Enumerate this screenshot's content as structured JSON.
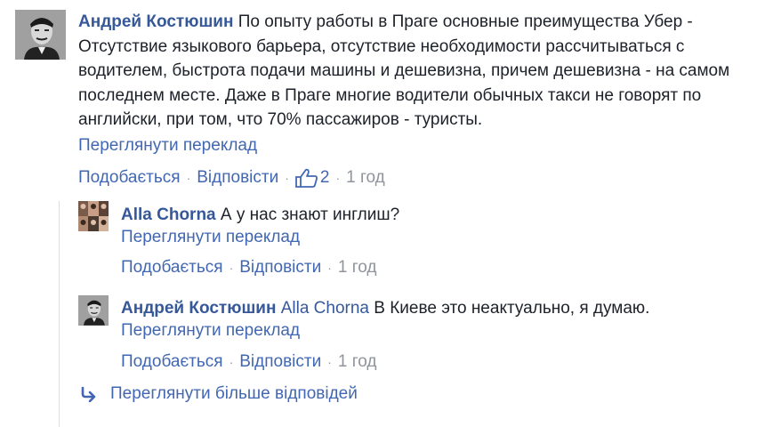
{
  "comment": {
    "author": "Андрей Костюшин",
    "text": "По опыту работы в Праге основные преимущества Убер - Отсутствие языкового барьера, отсутствие необходимости рассчитываться с водителем, быстрота подачи машины и дешевизна, причем дешевизна - на самом последнем месте. Даже в Праге многие водители обычных такси не говорят по английски, при том, что 70% пассажиров - туристы.",
    "translate_label": "Переглянути переклад",
    "like_label": "Подобається",
    "reply_label": "Відповісти",
    "reaction_count": "2",
    "time": "1 год",
    "separator": "·",
    "avatar_icon": "portrait-avatar-icon",
    "reaction_icon": "thumbs-up-icon"
  },
  "replies": [
    {
      "author": "Alla Chorna",
      "mention": "",
      "text": "А у нас знают инглиш?",
      "translate_label": "Переглянути переклад",
      "like_label": "Подобається",
      "reply_label": "Відповісти",
      "time": "1 год",
      "avatar_icon": "multi-photo-avatar-icon"
    },
    {
      "author": "Андрей Костюшин",
      "mention": "Alla Chorna",
      "text": "В Киеве это неактуально, я думаю.",
      "translate_label": "Переглянути переклад",
      "like_label": "Подобається",
      "reply_label": "Відповісти",
      "time": "1 год",
      "avatar_icon": "portrait-avatar-icon"
    }
  ],
  "more_replies": {
    "label": "Переглянути більше відповідей",
    "icon": "reply-arrow-icon"
  },
  "colors": {
    "link": "#4267b2",
    "author": "#365899",
    "meta": "#90949c",
    "text": "#1d2129",
    "rail": "#dddfe2"
  }
}
